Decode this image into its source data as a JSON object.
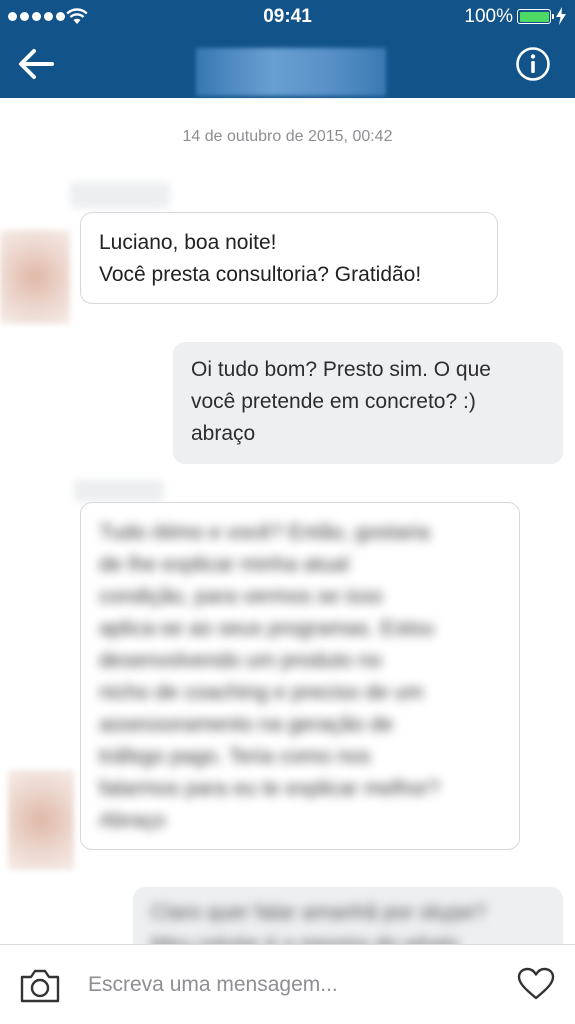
{
  "status_bar": {
    "time": "09:41",
    "battery": "100%"
  },
  "header": {
    "back_icon": "arrow-left-icon",
    "info_icon": "info-circle-icon"
  },
  "conversation": {
    "date": "14 de outubro de 2015, 00:42",
    "messages": [
      {
        "direction": "incoming",
        "lines": [
          "Luciano, boa noite!",
          "Você presta consultoria? Gratidão!"
        ]
      },
      {
        "direction": "outgoing",
        "lines": [
          "Oi tudo bom? Presto sim. O que",
          "você pretende em concreto? :)",
          "abraço"
        ]
      },
      {
        "direction": "incoming",
        "blurred": true,
        "lines": [
          "Tudo ótimo e você? Então, gostaria",
          "de lhe explicar minha atual",
          "condição, para vermos se isso",
          "aplica-se ao seus programas. Estou",
          "desenvolvendo um produto no",
          "nicho de coaching e preciso de um",
          "assessoramento na geração de",
          "tráfego pago. Teria como nos",
          "falarmos para eu te explicar melhor?",
          "Abraço"
        ]
      },
      {
        "direction": "outgoing",
        "blurred": true,
        "lines": [
          "Claro quer falar amanhã por skype?",
          "Meu celular é o mesmo do whats"
        ]
      }
    ]
  },
  "composer": {
    "placeholder": "Escreva uma mensagem...",
    "camera_icon": "camera-icon",
    "heart_icon": "heart-icon"
  },
  "colors": {
    "header_bg": "#12538a",
    "battery": "#4cd964",
    "outgoing_bubble": "#eeeff1"
  }
}
